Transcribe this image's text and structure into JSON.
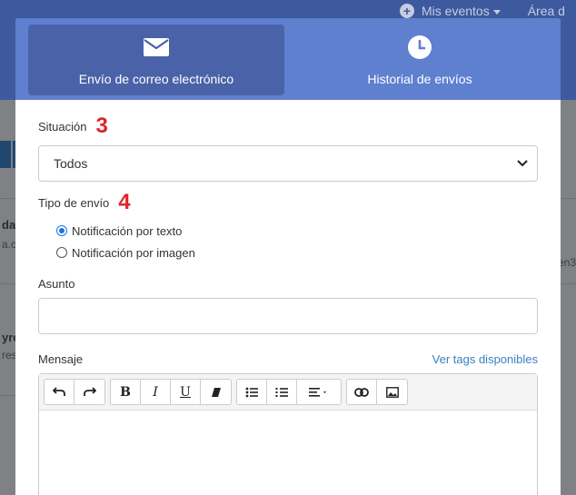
{
  "background": {
    "nav": {
      "events_label": "Mis eventos",
      "area_label": "Área d"
    },
    "snippets": [
      "da",
      "a.c",
      "yre",
      "res",
      "en3"
    ]
  },
  "modal": {
    "tabs": [
      {
        "label": "Envío de correo electrónico",
        "icon": "envelope-icon",
        "active": true
      },
      {
        "label": "Historial de envíos",
        "icon": "clock-icon",
        "active": false
      }
    ],
    "situation": {
      "label": "Situación",
      "step": "3",
      "selected": "Todos"
    },
    "send_type": {
      "label": "Tipo de envío",
      "step": "4",
      "options": [
        {
          "label": "Notificación por texto",
          "checked": true
        },
        {
          "label": "Notificación por imagen",
          "checked": false
        }
      ]
    },
    "subject": {
      "label": "Asunto",
      "value": ""
    },
    "message": {
      "label": "Mensaje",
      "tags_link": "Ver tags disponibles"
    },
    "colors": {
      "header": "#5f7fcf",
      "active_tab": "#4a62a8",
      "step_badge": "#e0242c",
      "link": "#3a7fc1"
    }
  }
}
